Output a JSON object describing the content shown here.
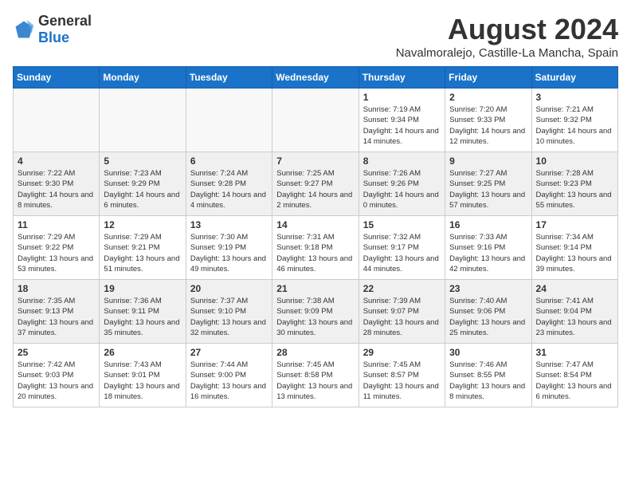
{
  "logo": {
    "general": "General",
    "blue": "Blue"
  },
  "title": {
    "month_year": "August 2024",
    "location": "Navalmoralejo, Castille-La Mancha, Spain"
  },
  "weekdays": [
    "Sunday",
    "Monday",
    "Tuesday",
    "Wednesday",
    "Thursday",
    "Friday",
    "Saturday"
  ],
  "weeks": [
    [
      {
        "day": "",
        "info": ""
      },
      {
        "day": "",
        "info": ""
      },
      {
        "day": "",
        "info": ""
      },
      {
        "day": "",
        "info": ""
      },
      {
        "day": "1",
        "info": "Sunrise: 7:19 AM\nSunset: 9:34 PM\nDaylight: 14 hours and 14 minutes."
      },
      {
        "day": "2",
        "info": "Sunrise: 7:20 AM\nSunset: 9:33 PM\nDaylight: 14 hours and 12 minutes."
      },
      {
        "day": "3",
        "info": "Sunrise: 7:21 AM\nSunset: 9:32 PM\nDaylight: 14 hours and 10 minutes."
      }
    ],
    [
      {
        "day": "4",
        "info": "Sunrise: 7:22 AM\nSunset: 9:30 PM\nDaylight: 14 hours and 8 minutes."
      },
      {
        "day": "5",
        "info": "Sunrise: 7:23 AM\nSunset: 9:29 PM\nDaylight: 14 hours and 6 minutes."
      },
      {
        "day": "6",
        "info": "Sunrise: 7:24 AM\nSunset: 9:28 PM\nDaylight: 14 hours and 4 minutes."
      },
      {
        "day": "7",
        "info": "Sunrise: 7:25 AM\nSunset: 9:27 PM\nDaylight: 14 hours and 2 minutes."
      },
      {
        "day": "8",
        "info": "Sunrise: 7:26 AM\nSunset: 9:26 PM\nDaylight: 14 hours and 0 minutes."
      },
      {
        "day": "9",
        "info": "Sunrise: 7:27 AM\nSunset: 9:25 PM\nDaylight: 13 hours and 57 minutes."
      },
      {
        "day": "10",
        "info": "Sunrise: 7:28 AM\nSunset: 9:23 PM\nDaylight: 13 hours and 55 minutes."
      }
    ],
    [
      {
        "day": "11",
        "info": "Sunrise: 7:29 AM\nSunset: 9:22 PM\nDaylight: 13 hours and 53 minutes."
      },
      {
        "day": "12",
        "info": "Sunrise: 7:29 AM\nSunset: 9:21 PM\nDaylight: 13 hours and 51 minutes."
      },
      {
        "day": "13",
        "info": "Sunrise: 7:30 AM\nSunset: 9:19 PM\nDaylight: 13 hours and 49 minutes."
      },
      {
        "day": "14",
        "info": "Sunrise: 7:31 AM\nSunset: 9:18 PM\nDaylight: 13 hours and 46 minutes."
      },
      {
        "day": "15",
        "info": "Sunrise: 7:32 AM\nSunset: 9:17 PM\nDaylight: 13 hours and 44 minutes."
      },
      {
        "day": "16",
        "info": "Sunrise: 7:33 AM\nSunset: 9:16 PM\nDaylight: 13 hours and 42 minutes."
      },
      {
        "day": "17",
        "info": "Sunrise: 7:34 AM\nSunset: 9:14 PM\nDaylight: 13 hours and 39 minutes."
      }
    ],
    [
      {
        "day": "18",
        "info": "Sunrise: 7:35 AM\nSunset: 9:13 PM\nDaylight: 13 hours and 37 minutes."
      },
      {
        "day": "19",
        "info": "Sunrise: 7:36 AM\nSunset: 9:11 PM\nDaylight: 13 hours and 35 minutes."
      },
      {
        "day": "20",
        "info": "Sunrise: 7:37 AM\nSunset: 9:10 PM\nDaylight: 13 hours and 32 minutes."
      },
      {
        "day": "21",
        "info": "Sunrise: 7:38 AM\nSunset: 9:09 PM\nDaylight: 13 hours and 30 minutes."
      },
      {
        "day": "22",
        "info": "Sunrise: 7:39 AM\nSunset: 9:07 PM\nDaylight: 13 hours and 28 minutes."
      },
      {
        "day": "23",
        "info": "Sunrise: 7:40 AM\nSunset: 9:06 PM\nDaylight: 13 hours and 25 minutes."
      },
      {
        "day": "24",
        "info": "Sunrise: 7:41 AM\nSunset: 9:04 PM\nDaylight: 13 hours and 23 minutes."
      }
    ],
    [
      {
        "day": "25",
        "info": "Sunrise: 7:42 AM\nSunset: 9:03 PM\nDaylight: 13 hours and 20 minutes."
      },
      {
        "day": "26",
        "info": "Sunrise: 7:43 AM\nSunset: 9:01 PM\nDaylight: 13 hours and 18 minutes."
      },
      {
        "day": "27",
        "info": "Sunrise: 7:44 AM\nSunset: 9:00 PM\nDaylight: 13 hours and 16 minutes."
      },
      {
        "day": "28",
        "info": "Sunrise: 7:45 AM\nSunset: 8:58 PM\nDaylight: 13 hours and 13 minutes."
      },
      {
        "day": "29",
        "info": "Sunrise: 7:45 AM\nSunset: 8:57 PM\nDaylight: 13 hours and 11 minutes."
      },
      {
        "day": "30",
        "info": "Sunrise: 7:46 AM\nSunset: 8:55 PM\nDaylight: 13 hours and 8 minutes."
      },
      {
        "day": "31",
        "info": "Sunrise: 7:47 AM\nSunset: 8:54 PM\nDaylight: 13 hours and 6 minutes."
      }
    ]
  ]
}
